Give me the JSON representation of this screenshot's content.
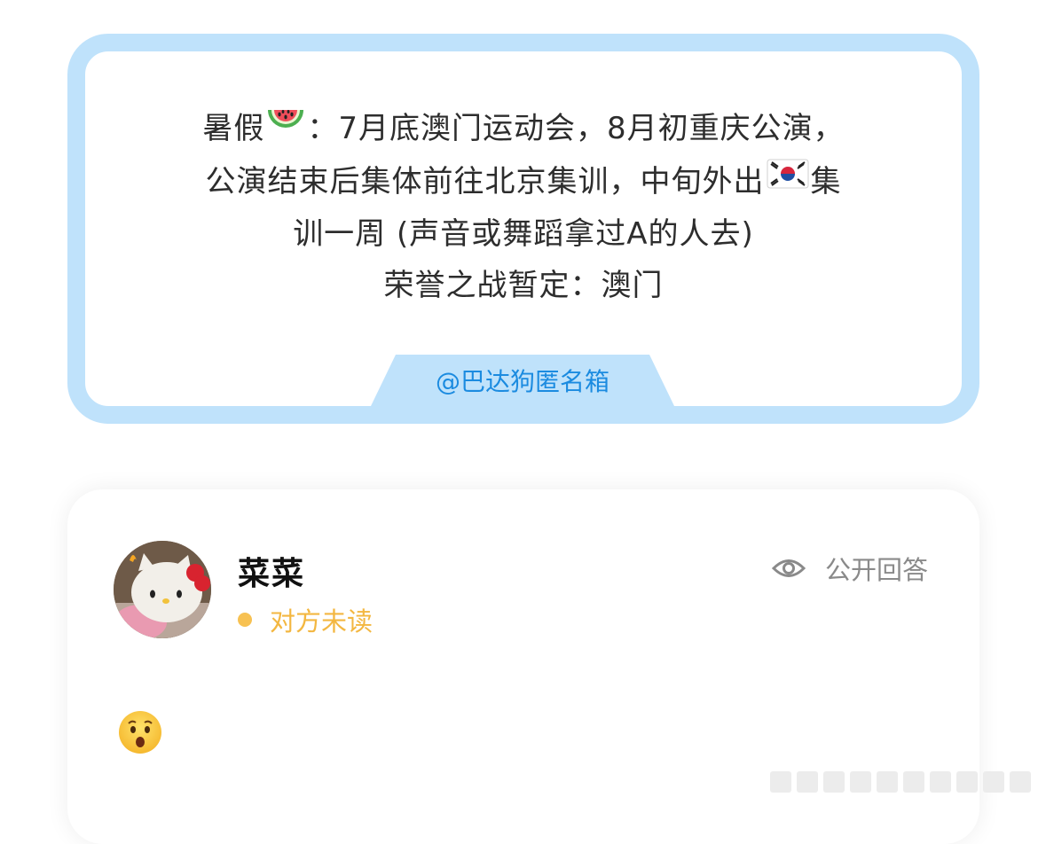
{
  "question": {
    "line1_a": "暑假",
    "line1_b": "：7月底澳门运动会，8月初重庆公演，",
    "line2_a": "公演结束后集体前往北京集训，中旬外出",
    "line2_b": "集",
    "line3": "训一周 (声音或舞蹈拿过A的人去)",
    "line4": "荣誉之战暂定：澳门",
    "emoji_1": "watermelon-icon",
    "emoji_2": "korea-flag-icon"
  },
  "source_tag": "@巴达狗匿名箱",
  "answer": {
    "user_name": "菜菜",
    "read_status": "对方未读",
    "visibility_label": "公开回答",
    "reply_emoji": "hushed-face-icon"
  },
  "colors": {
    "card_border": "#bfe2fb",
    "source_text": "#1b8be0",
    "status_yellow": "#f3b741",
    "muted_gray": "#8a8a8a"
  }
}
